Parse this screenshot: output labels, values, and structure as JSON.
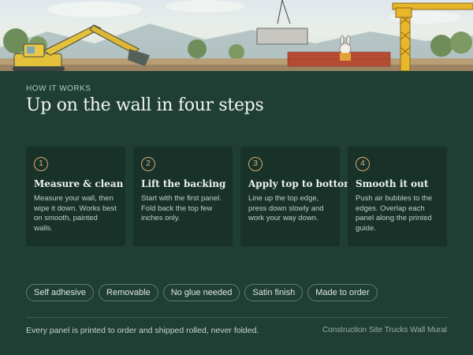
{
  "section": {
    "eyebrow": "HOW IT WORKS",
    "title": "Up on the wall in four steps"
  },
  "steps": [
    {
      "number": "1",
      "title": "Measure & clean",
      "body": "Measure your wall, then wipe it down. Works best on smooth, painted walls."
    },
    {
      "number": "2",
      "title": "Lift the backing",
      "body": "Start with the first panel. Fold back the top few inches only."
    },
    {
      "number": "3",
      "title": "Apply top to bottom",
      "body": "Line up the top edge, press down slowly and work your way down."
    },
    {
      "number": "4",
      "title": "Smooth it out",
      "body": "Push air bubbles to the edges. Overlap each panel along the printed guide."
    }
  ],
  "tags": [
    "Self adhesive",
    "Removable",
    "No glue needed",
    "Satin finish",
    "Made to order"
  ],
  "footer": {
    "note": "Every panel is printed to order and shipped rolled, never folded.",
    "product": "Construction Site Trucks Wall Mural"
  },
  "colors": {
    "background": "#1f3e34",
    "card": "#183229",
    "accent": "#d9a86e"
  },
  "hero": {
    "icons": [
      "excavator-icon",
      "crane-icon",
      "brick-wall-icon",
      "cartoon-bunny-icon",
      "trees-icon",
      "mountains-icon"
    ]
  }
}
